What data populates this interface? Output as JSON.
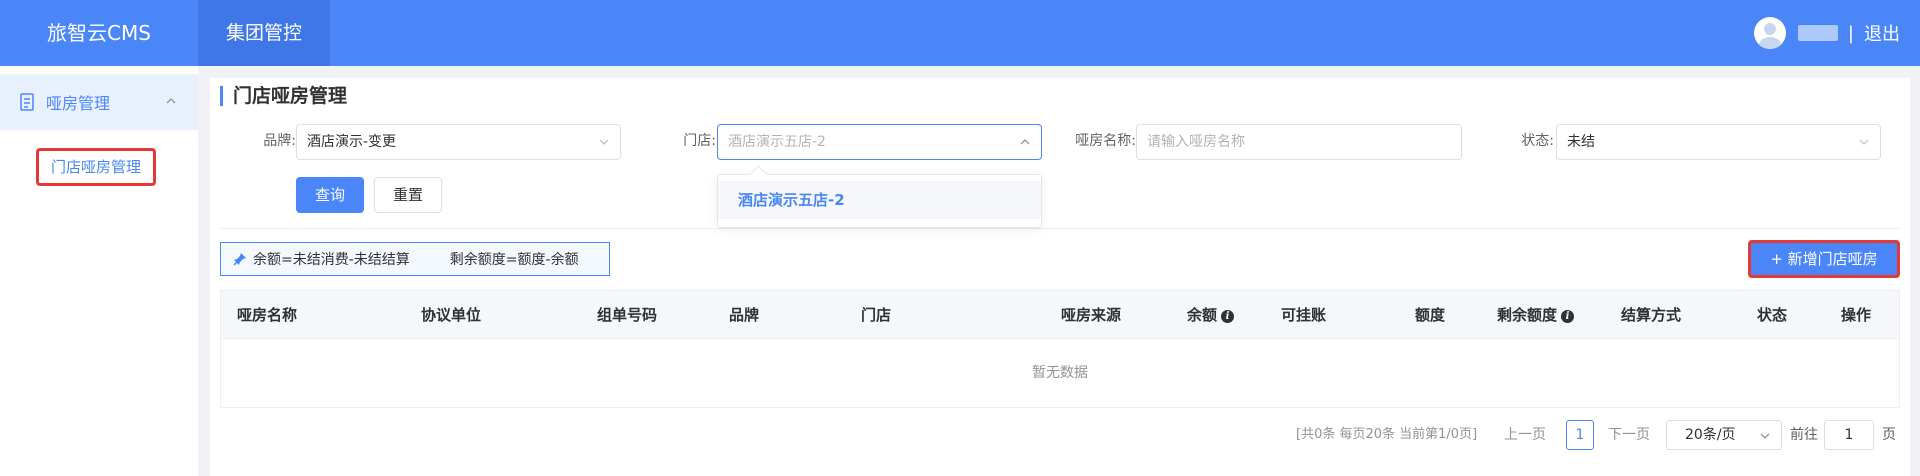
{
  "header": {
    "app_title": "旅智云CMS",
    "nav_tab": "集团管控",
    "separator": "|",
    "logout": "退出"
  },
  "sidebar": {
    "group_label": "哑房管理",
    "item_label": "门店哑房管理"
  },
  "page": {
    "title": "门店哑房管理"
  },
  "filters": {
    "brand_label": "品牌:",
    "brand_value": "酒店演示-变更",
    "store_label": "门店:",
    "store_placeholder": "酒店演示五店-2",
    "name_label": "哑房名称:",
    "name_placeholder": "请输入哑房名称",
    "status_label": "状态:",
    "status_value": "未结",
    "query_button": "查询",
    "reset_button": "重置",
    "store_options": [
      "酒店演示五店-2"
    ]
  },
  "notice": {
    "text1": "余额=未结消费-未结结算",
    "text2": "剩余额度=额度-余额"
  },
  "actions": {
    "add_button": "+ 新增门店哑房"
  },
  "table": {
    "columns": [
      "哑房名称",
      "协议单位",
      "组单号码",
      "品牌",
      "门店",
      "哑房来源",
      "余额",
      "可挂账",
      "额度",
      "剩余额度",
      "结算方式",
      "状态",
      "操作"
    ],
    "empty_text": "暂无数据"
  },
  "pagination": {
    "summary": "[共0条 每页20条 当前第1/0页]",
    "prev": "上一页",
    "current_page": "1",
    "next": "下一页",
    "page_size": "20条/页",
    "goto_label": "前往",
    "goto_value": "1",
    "goto_suffix": "页"
  },
  "colors": {
    "accent": "#4a86f7",
    "highlight_border": "#e53935"
  }
}
